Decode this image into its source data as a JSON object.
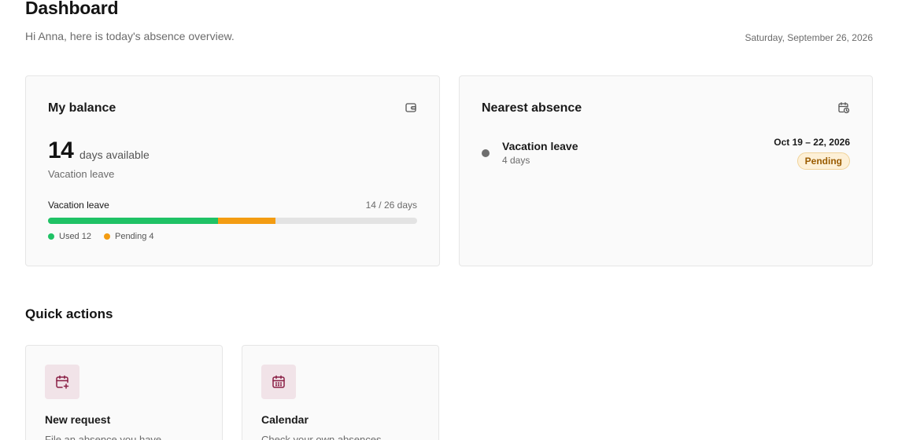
{
  "header": {
    "title": "Dashboard",
    "subtitle": "Hi Anna, here is today's absence overview.",
    "date": "Saturday, September 26, 2026"
  },
  "balance_card": {
    "title": "My balance",
    "icon": "wallet-icon",
    "days": "14",
    "days_label": "days available",
    "type": "Vacation leave",
    "bar": {
      "label": "Vacation leave",
      "count": "14 / 26 days",
      "total": 26,
      "used": 12,
      "pending": 4,
      "used_color": "#1fc265",
      "pending_color": "#f39c12"
    },
    "legend": {
      "used": "Used 12",
      "pending": "Pending 4"
    }
  },
  "nearest_card": {
    "title": "Nearest absence",
    "icon": "calendar-clock-icon",
    "absence_type": "Vacation leave",
    "duration": "4 days",
    "dates": "Oct 19 – 22, 2026",
    "status": "Pending"
  },
  "quick_actions": {
    "title": "Quick actions",
    "items": [
      {
        "title": "New request",
        "description": "File an absence you have",
        "icon": "calendar-plus-icon"
      },
      {
        "title": "Calendar",
        "description": "Check your own absences",
        "icon": "calendar-icon"
      }
    ]
  },
  "colors": {
    "accent": "#8a1f45",
    "accent_bg": "#f1e3e8"
  }
}
